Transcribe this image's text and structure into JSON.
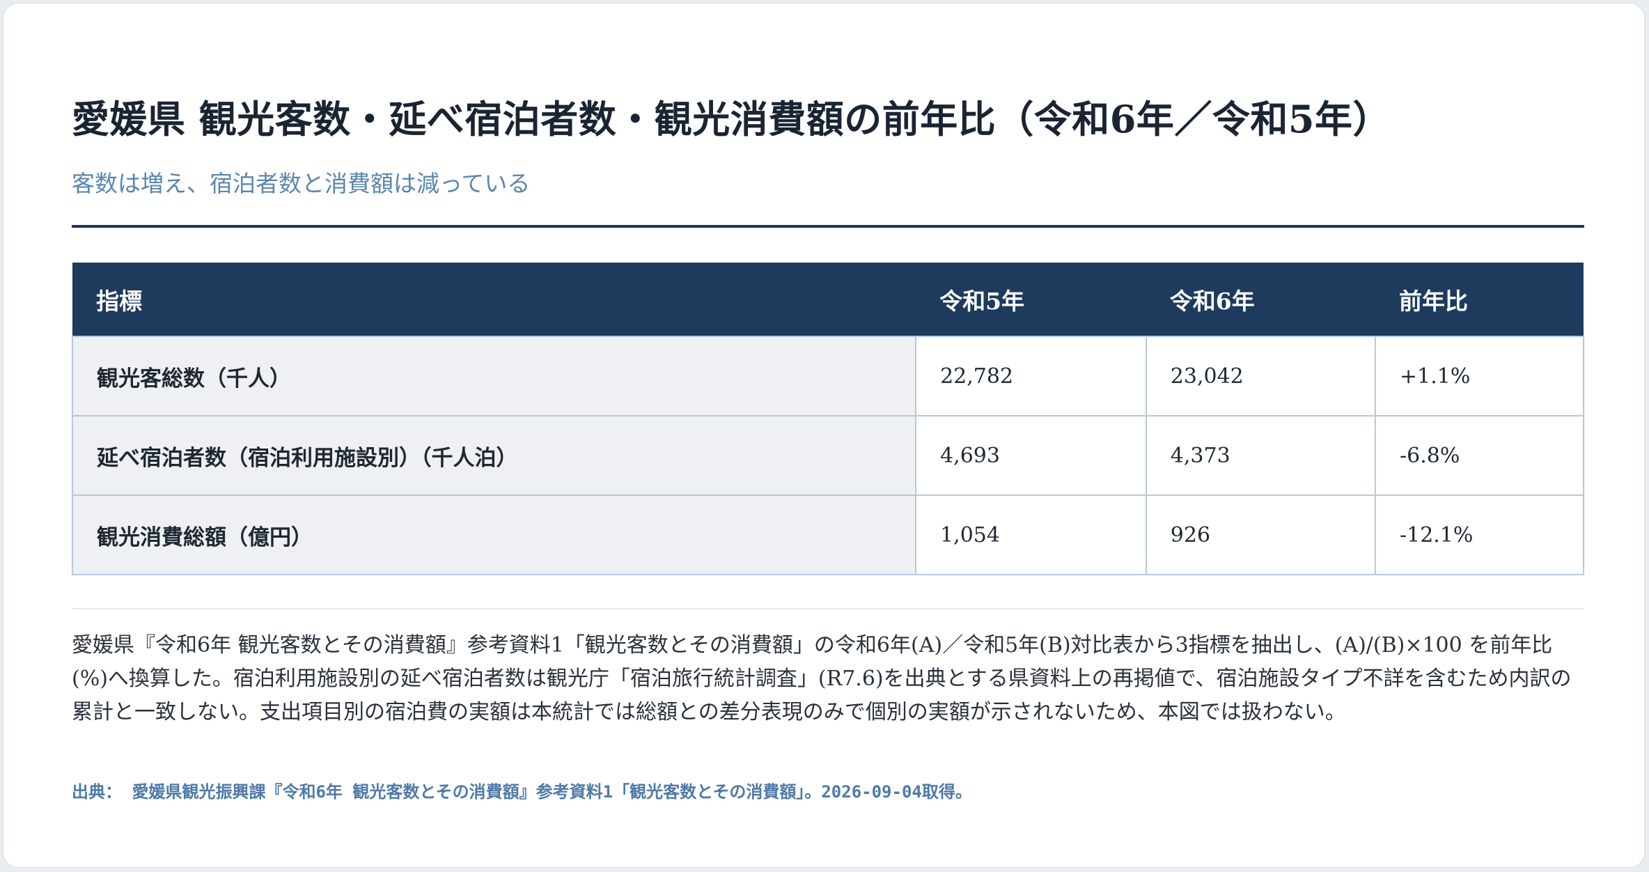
{
  "header": {
    "title": "愛媛県 観光客数・延べ宿泊者数・観光消費額の前年比（令和6年／令和5年）",
    "subtitle": "客数は増え、宿泊者数と消費額は減っている"
  },
  "chart_data": {
    "type": "table",
    "columns": [
      "指標",
      "令和5年",
      "令和6年",
      "前年比"
    ],
    "rows": [
      {
        "label": "観光客総数（千人）",
        "r5": "22,782",
        "r6": "23,042",
        "ratio": "+1.1%"
      },
      {
        "label": "延べ宿泊者数（宿泊利用施設別）（千人泊）",
        "r5": "4,693",
        "r6": "4,373",
        "ratio": "-6.8%"
      },
      {
        "label": "観光消費総額（億円）",
        "r5": "1,054",
        "r6": "926",
        "ratio": "-12.1%"
      }
    ]
  },
  "footer": {
    "note": "愛媛県『令和6年 観光客数とその消費額』参考資料1「観光客数とその消費額」の令和6年(A)／令和5年(B)対比表から3指標を抽出し、(A)/(B)×100 を前年比(%)へ換算した。宿泊利用施設別の延べ宿泊者数は観光庁「宿泊旅行統計調査」(R7.6)を出典とする県資料上の再掲値で、宿泊施設タイプ不詳を含むため内訳の累計と一致しない。支出項目別の宿泊費の実額は本統計では総額との差分表現のみで個別の実額が示されないため、本図では扱わない。",
    "source": "出典： 愛媛県観光振興課『令和6年 観光客数とその消費額』参考資料1「観光客数とその消費額」。2026-09-04取得。"
  },
  "colors": {
    "header_bg": "#1e3a5c",
    "rule": "#1c3656",
    "subtitle": "#5a86b0",
    "label_bg": "#eef0f3",
    "cell_border": "#b7c9dd"
  }
}
